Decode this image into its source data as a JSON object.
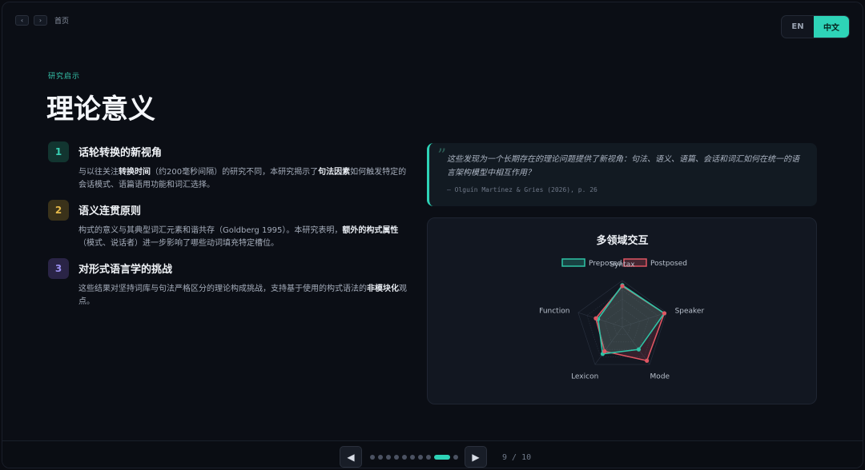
{
  "nav": {
    "prev_small": "‹",
    "next_small": "›",
    "home_label": "首页"
  },
  "lang": {
    "en": "EN",
    "zh": "中文",
    "active": "zh"
  },
  "kicker": "研究启示",
  "title": "理论意义",
  "points": [
    {
      "num": "1",
      "heading": "话轮转换的新视角",
      "body_parts": [
        {
          "text": "与以往关注",
          "bold": false
        },
        {
          "text": "转换时间",
          "bold": true
        },
        {
          "text": "（约200毫秒间隔）的研究不同，本研究揭示了",
          "bold": false
        },
        {
          "text": "句法因素",
          "bold": true
        },
        {
          "text": "如何触发特定的会话模式、语篇语用功能和词汇选择。",
          "bold": false
        }
      ]
    },
    {
      "num": "2",
      "heading": "语义连贯原则",
      "body_parts": [
        {
          "text": "构式的意义与其典型词汇元素和谐共存（Goldberg 1995）。本研究表明，",
          "bold": false
        },
        {
          "text": "额外的构式属性",
          "bold": true
        },
        {
          "text": "（模式、说话者）进一步影响了哪些动词填充特定槽位。",
          "bold": false
        }
      ]
    },
    {
      "num": "3",
      "heading": "对形式语言学的挑战",
      "body_parts": [
        {
          "text": "这些结果对坚持词库与句法严格区分的理论构成挑战，支持基于使用的构式语法的",
          "bold": false
        },
        {
          "text": "非模块化",
          "bold": true
        },
        {
          "text": "观点。",
          "bold": false
        }
      ]
    }
  ],
  "quote": {
    "mark": "”",
    "text": "这些发现为一个长期存在的理论问题提供了新视角：句法、语义、语篇、会话和词汇如何在统一的语言架构模型中相互作用？",
    "cite": "— Olguín Martínez & Gries (2026), p. 26"
  },
  "chart_data": {
    "type": "radar",
    "title": "多领域交互",
    "axes": [
      "Syntax",
      "Speaker",
      "Mode",
      "Lexicon",
      "Function"
    ],
    "range": [
      0,
      1
    ],
    "legend_position": "top",
    "series": [
      {
        "name": "Preposed",
        "values": [
          0.9,
          0.95,
          0.6,
          0.72,
          0.55
        ],
        "color": "#2ec4a6"
      },
      {
        "name": "Postposed",
        "values": [
          0.88,
          0.95,
          0.9,
          0.65,
          0.6
        ],
        "color": "#e05562"
      }
    ]
  },
  "pager": {
    "prev": "◀",
    "next": "▶",
    "current": 9,
    "total": 10,
    "label": "9 / 10"
  }
}
